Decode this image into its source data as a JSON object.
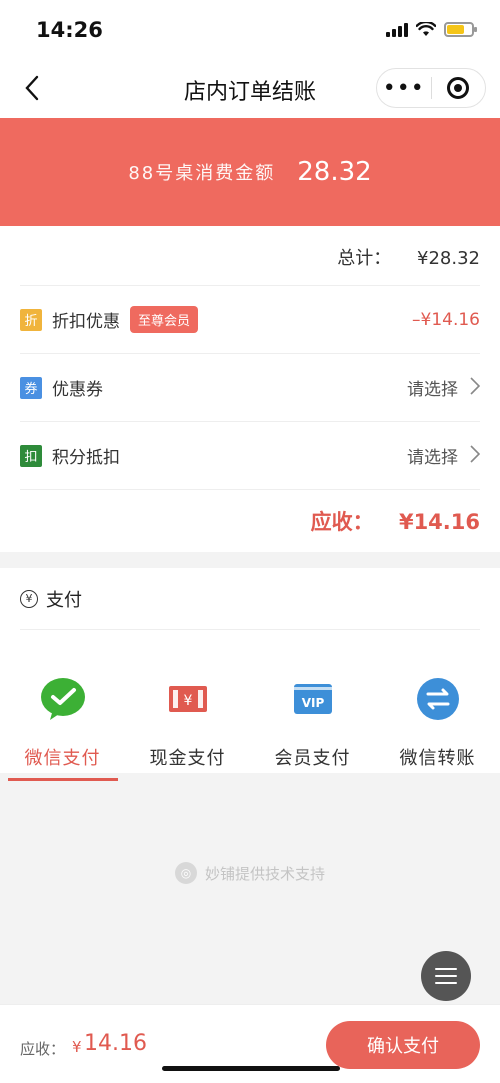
{
  "status": {
    "time": "14:26"
  },
  "nav": {
    "title": "店内订单结账",
    "more_icon": "•••"
  },
  "banner": {
    "label": "88号桌消费金额",
    "amount": "28.32"
  },
  "summary": {
    "total_label": "总计：",
    "total_value": "¥28.32",
    "rows": [
      {
        "icon_text": "折",
        "icon_color": "#f0b43c",
        "label": "折扣优惠",
        "badge": "至尊会员",
        "value": "–¥14.16"
      },
      {
        "icon_text": "券",
        "icon_color": "#4a90e2",
        "label": "优惠券",
        "value": "请选择"
      },
      {
        "icon_text": "扣",
        "icon_color": "#2e8b3a",
        "label": "积分抵扣",
        "value": "请选择"
      }
    ],
    "receivable_label": "应收：",
    "receivable_value": "¥14.16"
  },
  "payment": {
    "title": "支付",
    "methods": [
      {
        "label": "微信支付",
        "icon": "wechat-pay-icon",
        "color": "#3cb035",
        "active": true
      },
      {
        "label": "现金支付",
        "icon": "cash-icon",
        "color": "#e05a50",
        "active": false
      },
      {
        "label": "会员支付",
        "icon": "vip-icon",
        "color": "#3d8fd8",
        "active": false
      },
      {
        "label": "微信转账",
        "icon": "transfer-icon",
        "color": "#3d8fd8",
        "active": false
      }
    ]
  },
  "footer": {
    "powered_text": "妙铺提供技术支持"
  },
  "bottom": {
    "label": "应收：",
    "currency": "¥",
    "amount": "14.16",
    "confirm_label": "确认支付"
  },
  "colors": {
    "accent": "#ef6a5f",
    "accent_text": "#e05a50"
  }
}
